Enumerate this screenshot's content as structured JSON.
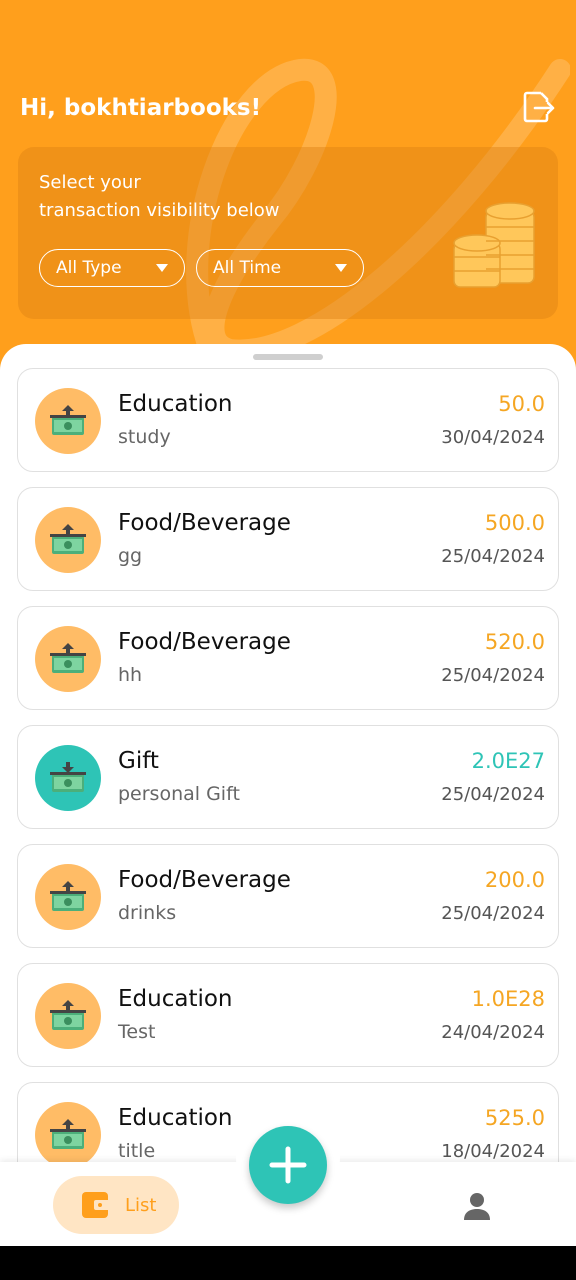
{
  "header": {
    "greeting": "Hi, bokhtiarbooks!",
    "filter_title_line1": "Select your",
    "filter_title_line2": "transaction visibility below",
    "type_filter": "All Type",
    "time_filter": "All Time"
  },
  "transactions": [
    {
      "category": "Education",
      "note": "study",
      "amount": "50.0",
      "date": "30/04/2024",
      "kind": "expense"
    },
    {
      "category": "Food/Beverage",
      "note": "gg",
      "amount": "500.0",
      "date": "25/04/2024",
      "kind": "expense"
    },
    {
      "category": "Food/Beverage",
      "note": "hh",
      "amount": "520.0",
      "date": "25/04/2024",
      "kind": "expense"
    },
    {
      "category": "Gift",
      "note": "personal Gift",
      "amount": "2.0E27",
      "date": "25/04/2024",
      "kind": "income"
    },
    {
      "category": "Food/Beverage",
      "note": "drinks",
      "amount": "200.0",
      "date": "25/04/2024",
      "kind": "expense"
    },
    {
      "category": "Education",
      "note": "Test",
      "amount": "1.0E28",
      "date": "24/04/2024",
      "kind": "expense"
    },
    {
      "category": "Education",
      "note": "title",
      "amount": "525.0",
      "date": "18/04/2024",
      "kind": "expense"
    }
  ],
  "nav": {
    "list_label": "List",
    "list_icon": "wallet-icon",
    "add_icon": "plus-icon",
    "profile_icon": "person-icon"
  },
  "colors": {
    "primary": "#FF9F1C",
    "expense_amount": "#F5A623",
    "income_amount": "#2EC4B6",
    "expense_icon_bg": "#FFBC66",
    "income_icon_bg": "#2EC4B6"
  }
}
